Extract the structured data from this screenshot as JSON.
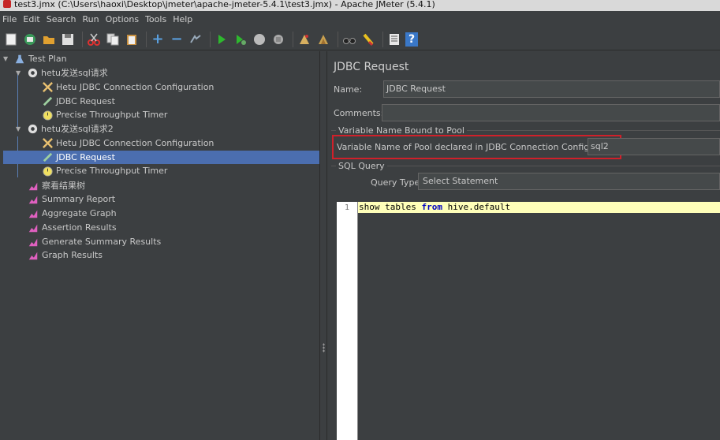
{
  "window": {
    "title": "test3.jmx (C:\\Users\\haoxi\\Desktop\\jmeter\\apache-jmeter-5.4.1\\test3.jmx) - Apache JMeter (5.4.1)"
  },
  "menu": [
    "File",
    "Edit",
    "Search",
    "Run",
    "Options",
    "Tools",
    "Help"
  ],
  "toolbar": {
    "icons": [
      "new-icon",
      "templates-icon",
      "open-icon",
      "save-icon",
      "cut-icon",
      "copy-icon",
      "paste-icon",
      "expand-icon",
      "collapse-icon",
      "toggle-icon",
      "start-icon",
      "start-no-pause-icon",
      "stop-icon",
      "shutdown-icon",
      "clear-icon",
      "clear-all-icon",
      "search-icon",
      "reset-search-icon",
      "function-helper-icon",
      "help-icon"
    ],
    "plus": "+",
    "minus": "−",
    "help": "?"
  },
  "tree": {
    "items": [
      {
        "label": "Test Plan"
      },
      {
        "label": "hetu发送sql请求"
      },
      {
        "label": "Hetu JDBC Connection Configuration"
      },
      {
        "label": "JDBC Request"
      },
      {
        "label": "Precise Throughput Timer"
      },
      {
        "label": "hetu发送sql请求2"
      },
      {
        "label": "Hetu JDBC Connection Configuration"
      },
      {
        "label": "JDBC Request"
      },
      {
        "label": "Precise Throughput Timer"
      },
      {
        "label": "察看结果树"
      },
      {
        "label": "Summary Report"
      },
      {
        "label": "Aggregate Graph"
      },
      {
        "label": "Assertion Results"
      },
      {
        "label": "Generate Summary Results"
      },
      {
        "label": "Graph Results"
      }
    ]
  },
  "panel": {
    "title": "JDBC Request",
    "name_label": "Name:",
    "name_value": "JDBC Request",
    "comments_label": "Comments:",
    "comments_value": "",
    "pool_group_title": "Variable Name Bound to Pool",
    "pool_label": "Variable Name of Pool declared in JDBC Connection Configuration:",
    "pool_value": "sql2",
    "sql_group_title": "SQL Query",
    "query_type_label": "Query Type:",
    "query_type_value": "Select Statement",
    "editor": {
      "line_number": "1",
      "code_pre": "show tables ",
      "code_kw": "from",
      "code_post": " hive.default"
    }
  },
  "colors": {
    "background": "#3c3f41",
    "selection": "#4b6eaf",
    "highlight_box": "#d0202a",
    "current_line": "#ffffb9"
  }
}
